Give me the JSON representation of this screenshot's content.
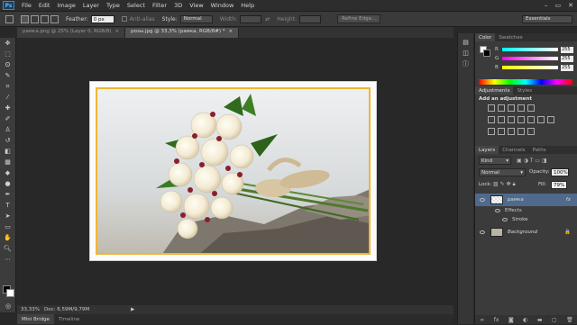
{
  "app": {
    "logo": "Ps"
  },
  "menu": [
    "File",
    "Edit",
    "Image",
    "Layer",
    "Type",
    "Select",
    "Filter",
    "3D",
    "View",
    "Window",
    "Help"
  ],
  "window_controls": [
    "–",
    "▭",
    "✕"
  ],
  "options": {
    "feather_label": "Feather:",
    "feather_value": "0 px",
    "antialias_label": "Anti-alias",
    "style_label": "Style:",
    "style_value": "Normal",
    "width_label": "Width:",
    "height_label": "Height:",
    "refine_edge": "Refine Edge...",
    "workspace": "Essentials"
  },
  "doc_tabs": [
    {
      "label": "рамка.png @ 25% (Layer 0, RGB/8)",
      "close": "×",
      "active": false
    },
    {
      "label": "розы.jpg @ 33,3% (рамка, RGB/8#) *",
      "close": "×",
      "active": true
    }
  ],
  "status": {
    "zoom": "33,33%",
    "doc": "Doc: 6,59M/9,79M",
    "arrow": "▶"
  },
  "bottom_tabs": [
    "Mini Bridge",
    "Timeline"
  ],
  "color_panel": {
    "tabs": [
      "Color",
      "Swatches"
    ],
    "channels": [
      {
        "name": "R",
        "value": "255"
      },
      {
        "name": "G",
        "value": "255"
      },
      {
        "name": "B",
        "value": "255"
      }
    ]
  },
  "adjustments_panel": {
    "tabs": [
      "Adjustments",
      "Styles"
    ],
    "title": "Add an adjustment",
    "icons_row1": [
      "brightness-icon",
      "levels-icon",
      "curves-icon",
      "exposure-icon",
      "triangle-icon"
    ],
    "icons_row2": [
      "vibrance-icon",
      "hue-icon",
      "balance-icon",
      "bw-icon",
      "photo-filter-icon",
      "channel-mixer-icon",
      "grid-icon"
    ],
    "icons_row3": [
      "invert-icon",
      "posterize-icon",
      "threshold-icon",
      "gradient-map-icon",
      "selective-color-icon"
    ]
  },
  "layers_panel": {
    "tabs": [
      "Layers",
      "Channels",
      "Paths"
    ],
    "kind_label": "Kind",
    "blend_mode": "Normal",
    "opacity_label": "Opacity:",
    "opacity_value": "100%",
    "lock_label": "Lock:",
    "fill_label": "Fill:",
    "fill_value": "79%",
    "layers": [
      {
        "name": "рамка",
        "fx": "fx",
        "effects_label": "Effects",
        "effects": [
          "Stroke"
        ]
      },
      {
        "name": "Background",
        "lock": "🔒"
      }
    ],
    "bottom_icons": [
      "link-icon",
      "fx-icon",
      "mask-icon",
      "adjustment-icon",
      "folder-icon",
      "new-layer-icon",
      "trash-icon"
    ]
  },
  "colors": {
    "frame_gold": "#f1b534",
    "ps_blue": "#58b6ff",
    "selected_layer": "#4f6a8c"
  }
}
